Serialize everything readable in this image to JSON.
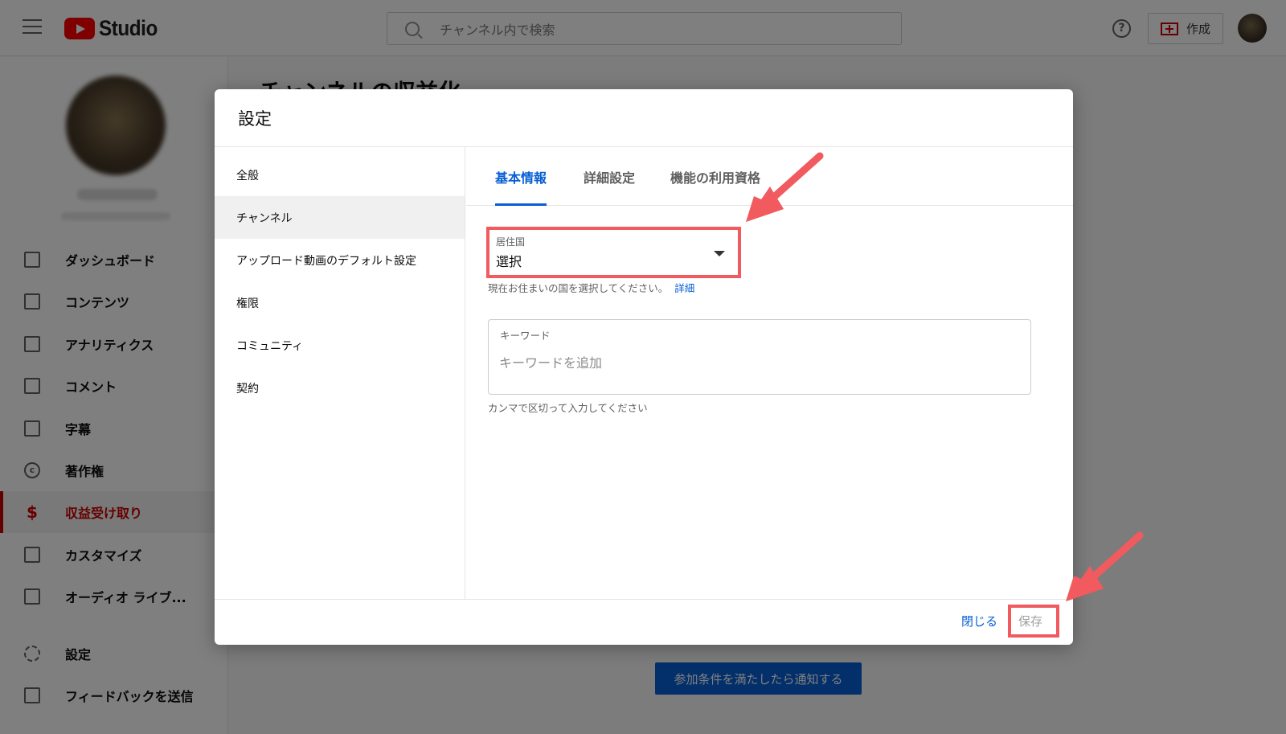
{
  "app": {
    "logo_text": "Studio",
    "search_placeholder": "チャンネル内で検索",
    "create_label": "作成"
  },
  "sidebar": {
    "items": [
      {
        "label": "ダッシュボード"
      },
      {
        "label": "コンテンツ"
      },
      {
        "label": "アナリティクス"
      },
      {
        "label": "コメント"
      },
      {
        "label": "字幕"
      },
      {
        "label": "著作権"
      },
      {
        "label": "収益受け取り",
        "active": true
      },
      {
        "label": "カスタマイズ"
      },
      {
        "label": "オーディオ ライブ..."
      },
      {
        "label": "設定"
      },
      {
        "label": "フィードバックを送信"
      }
    ]
  },
  "main": {
    "title": "チャンネルの収益化",
    "notify_button": "参加条件を満たしたら通知する"
  },
  "dialog": {
    "title": "設定",
    "nav": [
      {
        "label": "全般"
      },
      {
        "label": "チャンネル",
        "selected": true
      },
      {
        "label": "アップロード動画のデフォルト設定"
      },
      {
        "label": "権限"
      },
      {
        "label": "コミュニティ"
      },
      {
        "label": "契約"
      }
    ],
    "tabs": [
      {
        "label": "基本情報",
        "active": true
      },
      {
        "label": "詳細設定"
      },
      {
        "label": "機能の利用資格"
      }
    ],
    "country": {
      "label": "居住国",
      "value": "選択",
      "help": "現在お住まいの国を選択してください。",
      "help_link": "詳細"
    },
    "keywords": {
      "label": "キーワード",
      "placeholder": "キーワードを追加",
      "help": "カンマで区切って入力してください"
    },
    "close_label": "閉じる",
    "save_label": "保存"
  },
  "colors": {
    "accent_blue": "#065fd4",
    "brand_red": "#ff0000",
    "annotation_red": "#f15a5e"
  }
}
